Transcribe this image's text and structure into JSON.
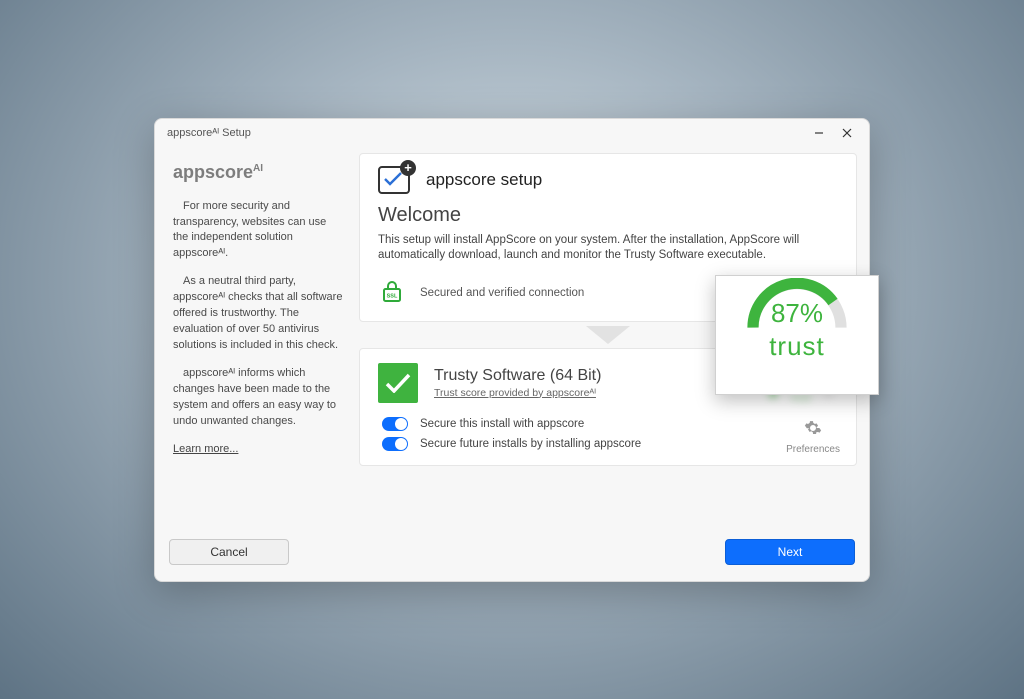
{
  "window_title": "appscoreᴬᴵ Setup",
  "brand_main": "appscore",
  "brand_sup": "AI",
  "sidebar": {
    "p1": "For more security and transparency, websites can use the independent solution appscoreᴬᴵ.",
    "p2": "As a neutral third party, appscoreᴬᴵ checks that all software offered is trustworthy. The evaluation of over 50 antivirus solutions is included in this check.",
    "p3": "appscoreᴬᴵ informs which changes have been made to the system and offers an easy way to undo unwanted changes.",
    "learn_more": "Learn more..."
  },
  "top": {
    "title": "appscore setup",
    "welcome": "Welcome",
    "desc": "This setup will install AppScore on your system. After the installation, AppScore will automatically download, launch and monitor the Trusty Software executable.",
    "secure": "Secured and verified connection"
  },
  "soft": {
    "name": "Trusty Software (64 Bit)",
    "score": "Trust score provided by appscoreᴬᴵ",
    "toggle1": "Secure this install with appscore",
    "toggle2": "Secure future installs by installing appscore",
    "prefs": "Preferences"
  },
  "gauge": {
    "percent": "87%",
    "label": "trust"
  },
  "buttons": {
    "cancel": "Cancel",
    "next": "Next"
  }
}
